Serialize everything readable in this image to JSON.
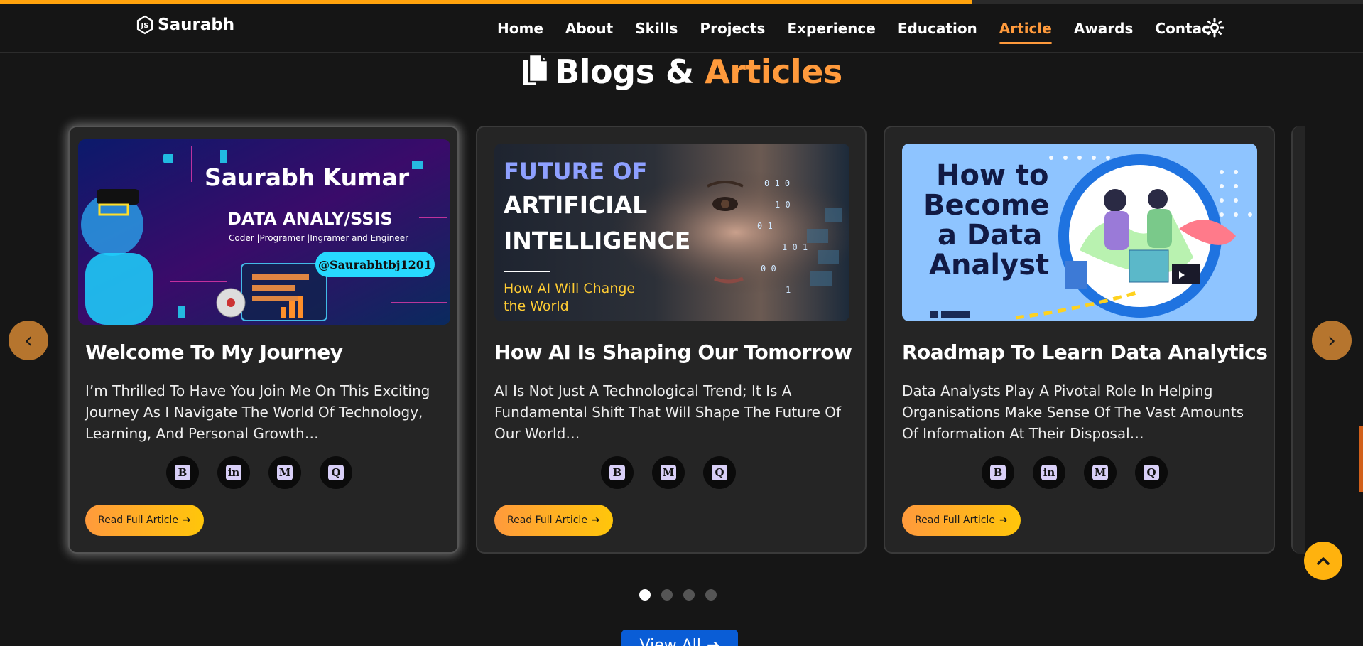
{
  "progress": {
    "fraction": 0.713
  },
  "navbar": {
    "brand": "Saurabh",
    "links": [
      "Home",
      "About",
      "Skills",
      "Projects",
      "Experience",
      "Education",
      "Article",
      "Awards",
      "Contact"
    ],
    "active_link": "Article",
    "theme_icon": "sun-icon"
  },
  "section": {
    "title_main": "Blogs & ",
    "title_accent": "Articles",
    "icon": "document-copy-icon"
  },
  "cards": [
    {
      "image": {
        "name": "Saurabh Kumar",
        "heading": "DATA ANALY/SSIS",
        "subheading": "Coder |Programer |Ingramer and Engineer",
        "handle": "@Saurabhtbj1201"
      },
      "title": "Welcome To My Journey",
      "description": "I’m Thrilled To Have You Join Me On This Exciting Journey As I Navigate The World Of Technology, Learning, And Personal Growth…",
      "socials": [
        "B",
        "in",
        "M",
        "Q"
      ],
      "button": "Read Full Article"
    },
    {
      "image": {
        "line1": "FUTURE OF",
        "line2": "ARTIFICIAL",
        "line3": "INTELLIGENCE",
        "sub1": "How AI Will Change",
        "sub2": "the World"
      },
      "title": "How AI Is Shaping Our Tomorrow",
      "description": "AI Is Not Just A Technological Trend; It Is A Fundamental Shift That Will Shape The Future Of Our World…",
      "socials": [
        "B",
        "M",
        "Q"
      ],
      "button": "Read Full Article"
    },
    {
      "image": {
        "line1": "How to",
        "line2": "Become",
        "line3": "a Data",
        "line4": "Analyst"
      },
      "title": "Roadmap To Learn Data Analytics",
      "description": "Data Analysts Play A Pivotal Role In Helping Organisations Make Sense Of The Vast Amounts Of Information At Their Disposal…",
      "socials": [
        "B",
        "in",
        "M",
        "Q"
      ],
      "button": "Read Full Article"
    }
  ],
  "carousel": {
    "prev": "‹",
    "next": "›",
    "page_count": 4,
    "active_page": 1
  },
  "view_all": "View All",
  "colors": {
    "accent": "#ff9a3c",
    "button_from": "#ff9a3c",
    "button_to": "#ffc60a",
    "view_all": "#0a5dd6"
  }
}
